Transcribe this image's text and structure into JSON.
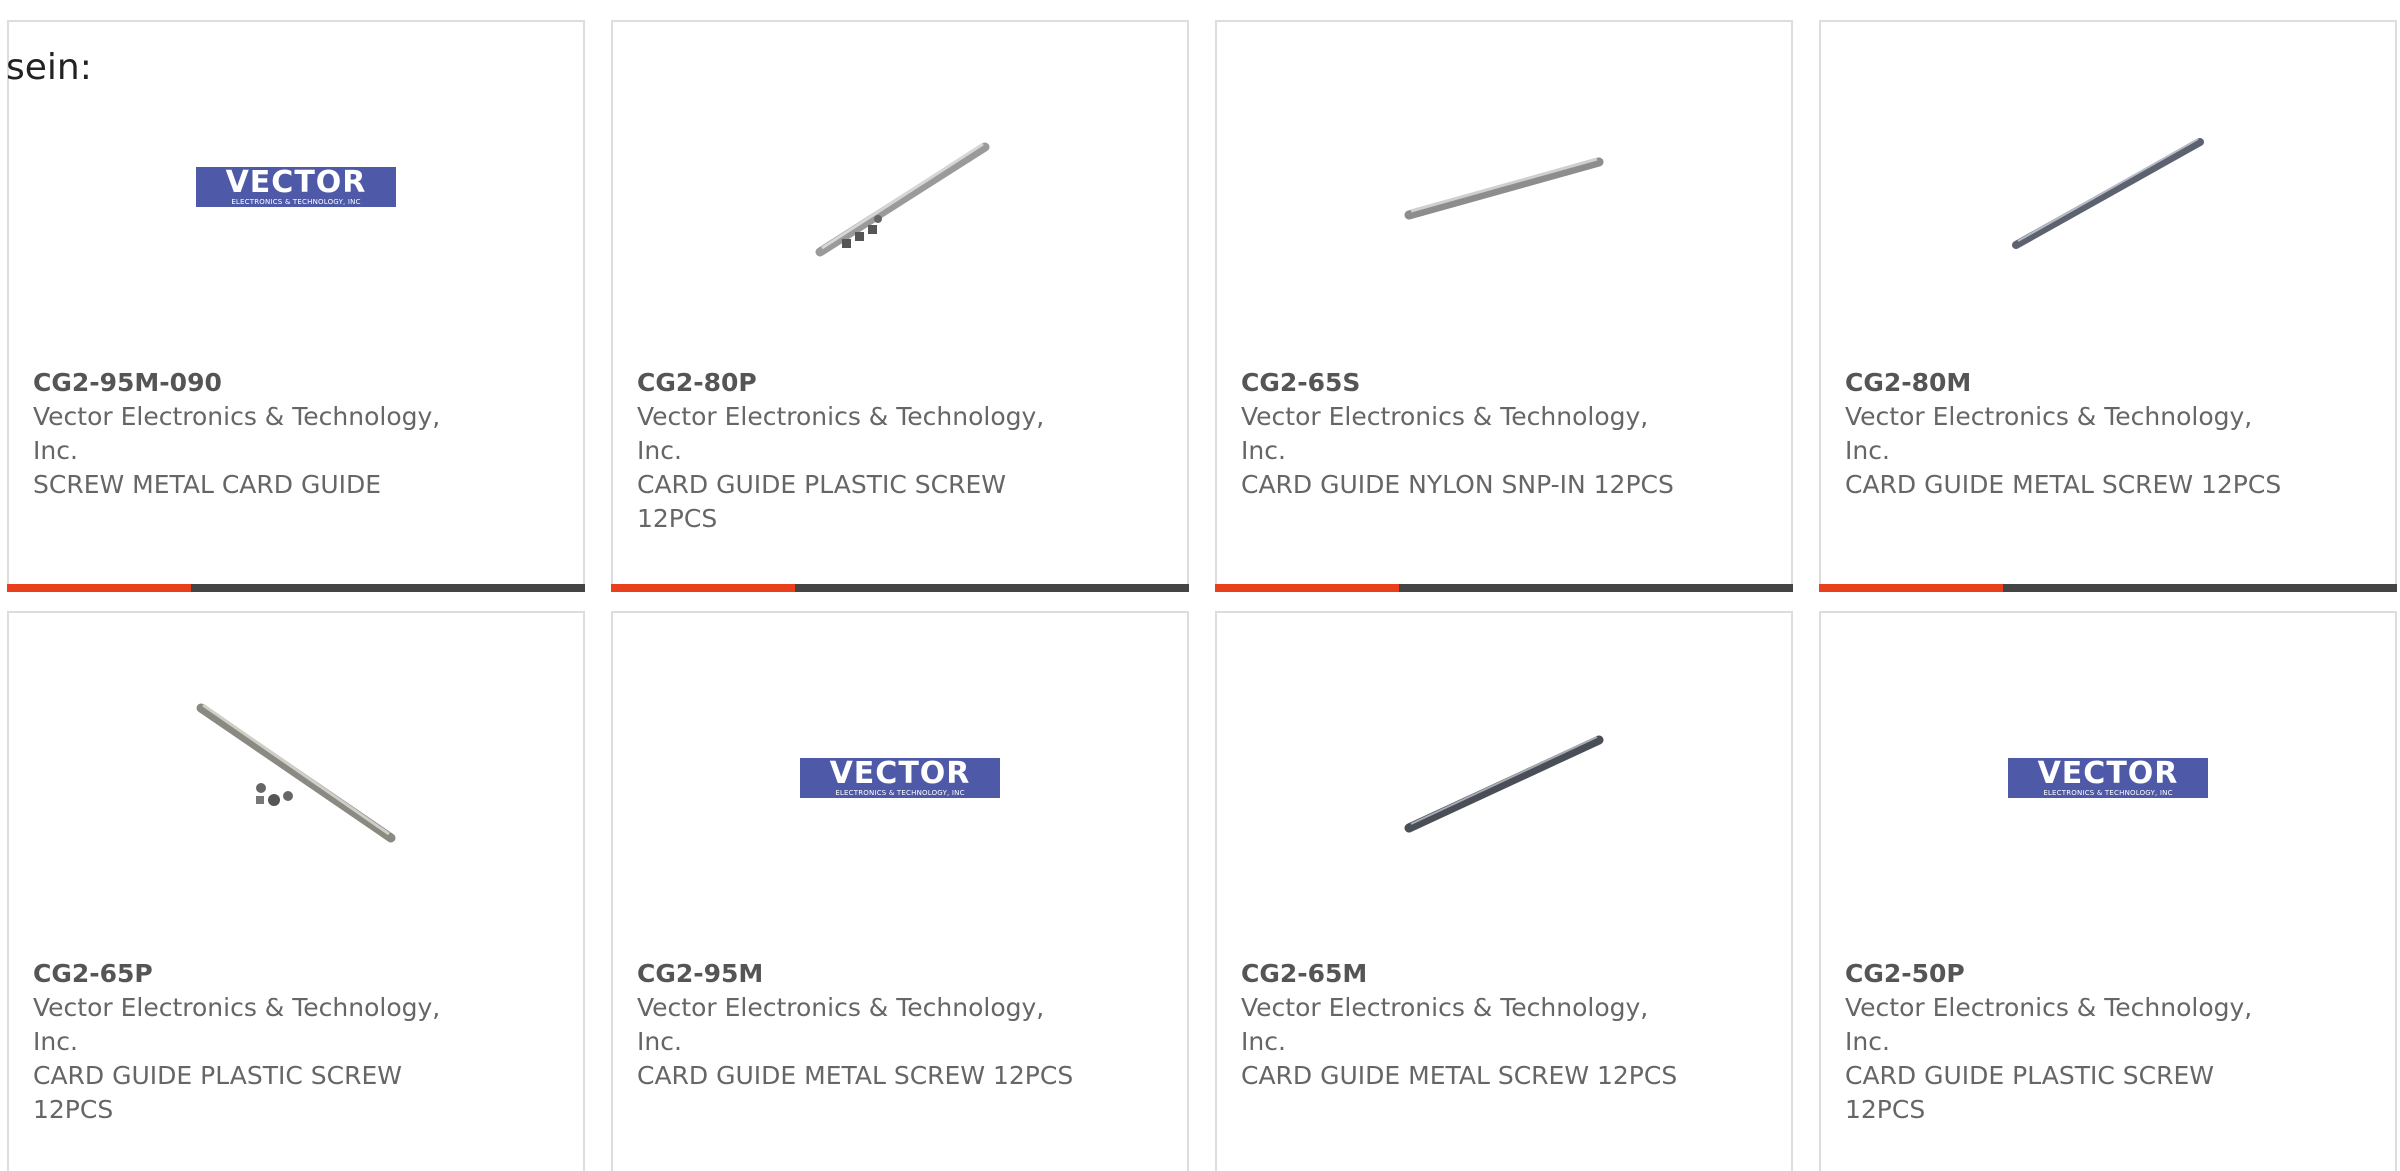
{
  "intro_text": "sein:",
  "logo": {
    "main": "VECTOR",
    "sub": "ELECTRONICS & TECHNOLOGY, INC"
  },
  "colors": {
    "accent": "#e8401c",
    "bar": "#444444",
    "logo_bg": "#4e5aa7",
    "card_border": "#dddddd"
  },
  "products": [
    {
      "part": "CG2-95M-090",
      "manufacturer": "Vector Electronics & Technology, Inc.",
      "description": "SCREW METAL CARD GUIDE",
      "image": "vector-logo"
    },
    {
      "part": "CG2-80P",
      "manufacturer": "Vector Electronics & Technology, Inc.",
      "description": "CARD GUIDE PLASTIC SCREW 12PCS",
      "image": "card-guide-rail-with-screws"
    },
    {
      "part": "CG2-65S",
      "manufacturer": "Vector Electronics & Technology, Inc.",
      "description": "CARD GUIDE NYLON SNP-IN 12PCS",
      "image": "card-guide-rail"
    },
    {
      "part": "CG2-80M",
      "manufacturer": "Vector Electronics & Technology, Inc.",
      "description": "CARD GUIDE METAL SCREW 12PCS",
      "image": "card-guide-rail"
    },
    {
      "part": "CG2-65P",
      "manufacturer": "Vector Electronics & Technology, Inc.",
      "description": "CARD GUIDE PLASTIC SCREW 12PCS",
      "image": "card-guide-rail-with-screws"
    },
    {
      "part": "CG2-95M",
      "manufacturer": "Vector Electronics & Technology, Inc.",
      "description": "CARD GUIDE METAL SCREW 12PCS",
      "image": "vector-logo"
    },
    {
      "part": "CG2-65M",
      "manufacturer": "Vector Electronics & Technology, Inc.",
      "description": "CARD GUIDE METAL SCREW 12PCS",
      "image": "card-guide-rail"
    },
    {
      "part": "CG2-50P",
      "manufacturer": "Vector Electronics & Technology, Inc.",
      "description": "CARD GUIDE PLASTIC SCREW 12PCS",
      "image": "vector-logo"
    }
  ]
}
